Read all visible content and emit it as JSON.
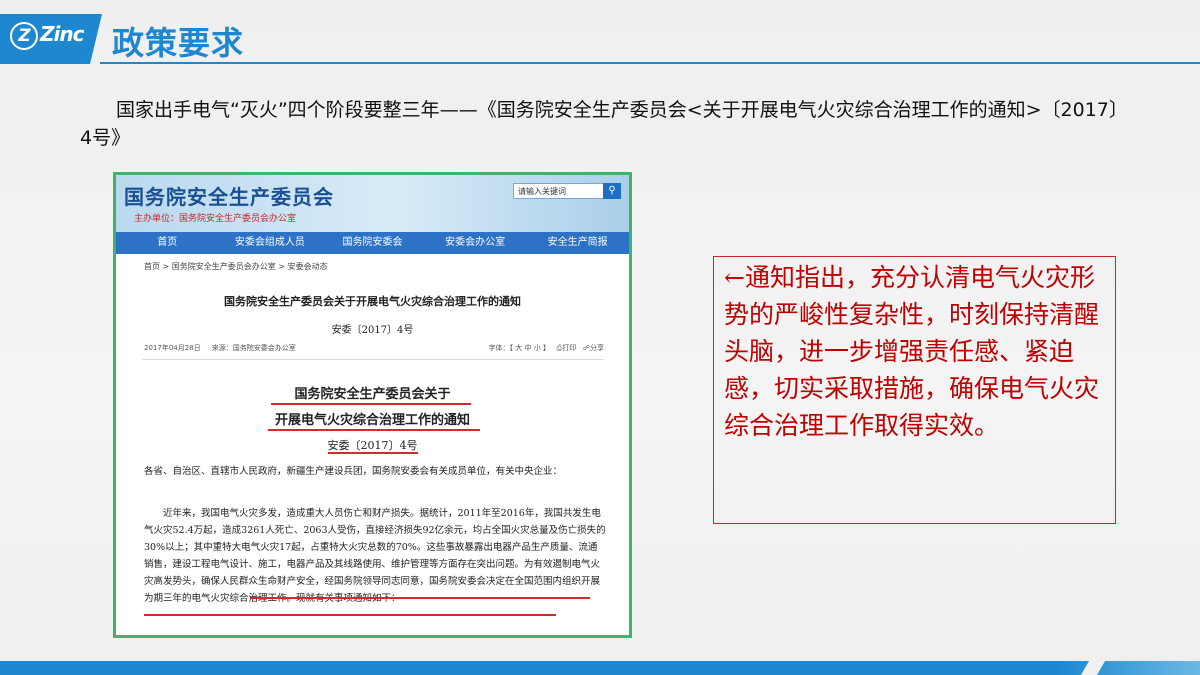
{
  "header": {
    "logo_text": "Zinc",
    "title": "政策要求"
  },
  "intro": "国家出手电气“灭火”四个阶段要整三年——《国务院安全生产委员会<关于开展电气火灾综合治理工作的通知>〔2017〕4号》",
  "website": {
    "site_name": "国务院安全生产委员会",
    "subtitle": "主办单位：国务院安全生产委员会办公室",
    "search_placeholder": "请输入关键词",
    "nav": [
      "首页",
      "安委会组成人员",
      "国务院安委会",
      "安委会办公室",
      "安全生产简报"
    ],
    "breadcrumb": "首页 > 国务院安全生产委员会办公室 > 安委会动态",
    "notice_title": "国务院安全生产委员会关于开展电气火灾综合治理工作的通知",
    "doc_number": "安委〔2017〕4号",
    "date": "2017年04月28日",
    "source": "来源：国务院安委会办公室",
    "font_size_label": "字体：【 大 中 小 】",
    "print_label": "打印",
    "share_label": "分享",
    "heading_line1": "国务院安全生产委员会关于",
    "heading_line2": "开展电气火灾综合治理工作的通知",
    "heading_number": "安委〔2017〕4号",
    "salutation": "各省、自治区、直辖市人民政府，新疆生产建设兵团，国务院安委会有关成员单位，有关中央企业：",
    "paragraph": "近年来，我国电气火灾多发，造成重大人员伤亡和财产损失。据统计，2011年至2016年，我国共发生电气火灾52.4万起，造成3261人死亡、2063人受伤，直接经济损失92亿余元，均占全国火灾总量及伤亡损失的30%以上；其中重特大电气火灾17起，占重特大火灾总数的70%。这些事故暴露出电器产品生产质量、流通销售，建设工程电气设计、施工，电器产品及其线路使用、维护管理等方面存在突出问题。为有效遏制电气火灾高发势头，确保人民群众生命财产安全，经国务院领导同志同意，国务院安委会决定在全国范围内组织开展为期三年的电气火灾综合治理工作。现就有关事项通知如下："
  },
  "callout": "←通知指出，充分认清电气火灾形势的严峻性复杂性，时刻保持清醒头脑，进一步增强责任感、紧迫感，切实采取措施，确保电气火灾综合治理工作取得实效。",
  "colors": {
    "accent": "#1d87cf",
    "frame": "#3fb36b",
    "callout": "#c00000"
  }
}
